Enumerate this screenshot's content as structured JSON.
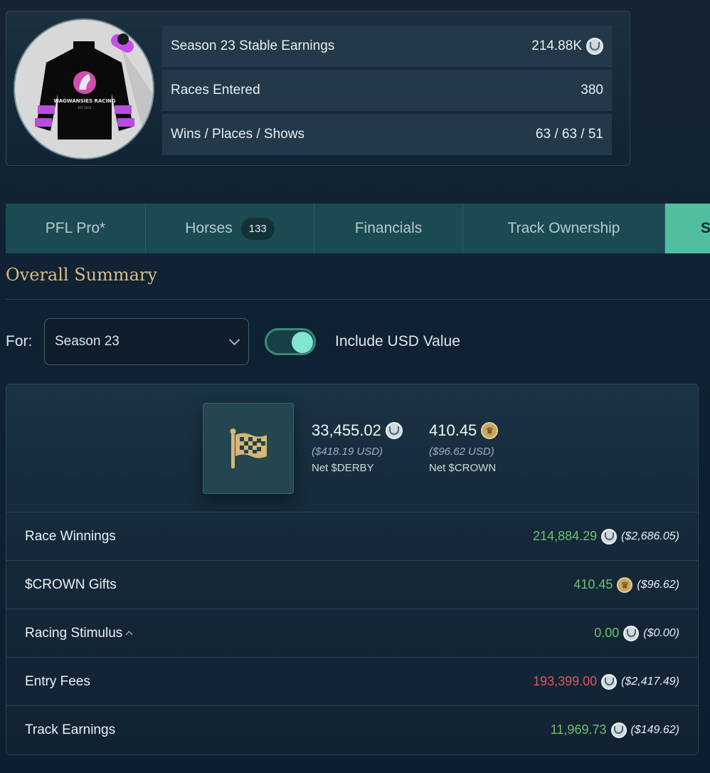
{
  "stable": {
    "silks_name": "WAGWANSIES RACING",
    "silks_est": "EST 2023",
    "stats": [
      {
        "label": "Season 23 Stable Earnings",
        "value": "214.88K",
        "coin": "derby"
      },
      {
        "label": "Races Entered",
        "value": "380",
        "coin": null
      },
      {
        "label": "Wins / Places / Shows",
        "value": "63 / 63 / 51",
        "coin": null
      }
    ]
  },
  "tabs": [
    {
      "label": "PFL Pro*"
    },
    {
      "label": "Horses",
      "badge": "133"
    },
    {
      "label": "Financials"
    },
    {
      "label": "Track Ownership"
    },
    {
      "label": "S"
    }
  ],
  "summary": {
    "title": "Overall Summary",
    "for_label": "For:",
    "season_select": "Season 23",
    "toggle_label": "Include USD Value",
    "toggle_on": true
  },
  "net": [
    {
      "amount": "33,455.02",
      "usd": "($418.19 USD)",
      "label": "Net $DERBY",
      "coin": "derby"
    },
    {
      "amount": "410.45",
      "usd": "($96.62 USD)",
      "label": "Net $CROWN",
      "coin": "crown"
    }
  ],
  "rows": [
    {
      "label": "Race Winnings",
      "amount": "214,884.29",
      "usd": "($2,686.05)",
      "coin": "derby",
      "status": "positive"
    },
    {
      "label": "$CROWN Gifts",
      "amount": "410.45",
      "usd": "($96.62)",
      "coin": "crown",
      "status": "positive"
    },
    {
      "label": "Racing Stimulus",
      "amount": "0.00",
      "usd": "($0.00)",
      "coin": "derby",
      "status": "positive",
      "expandable": true
    },
    {
      "label": "Entry Fees",
      "amount": "193,399.00",
      "usd": "($2,417.49)",
      "coin": "derby",
      "status": "negative"
    },
    {
      "label": "Track Earnings",
      "amount": "11,969.73",
      "usd": "($149.62)",
      "coin": "derby",
      "status": "positive"
    }
  ],
  "colors": {
    "positive": "#6fc06f",
    "negative": "#e0575d",
    "accent": "#4fbf9f",
    "title": "#d6bd86"
  }
}
